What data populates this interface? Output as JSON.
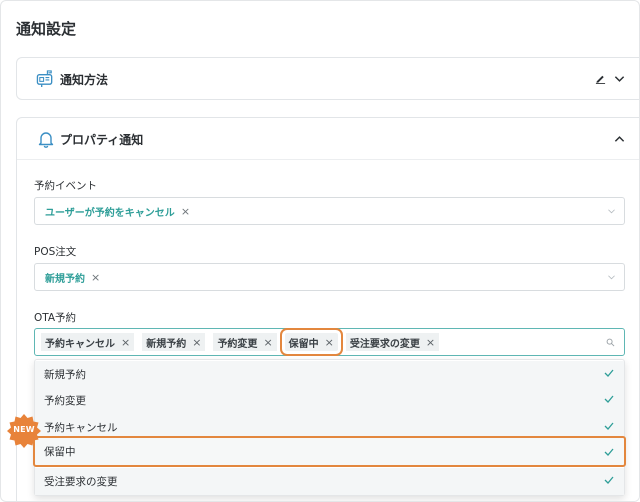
{
  "page": {
    "title": "通知設定"
  },
  "notify_method": {
    "title": "通知方法"
  },
  "property_notify": {
    "title": "プロパティ通知"
  },
  "reservation_event": {
    "label": "予約イベント",
    "chips": [
      {
        "label": "ユーザーが予約をキャンセル"
      }
    ]
  },
  "pos_order": {
    "label": "POS注文",
    "chips": [
      {
        "label": "新規予約"
      }
    ]
  },
  "ota_reservation": {
    "label": "OTA予約",
    "chips": [
      {
        "label": "予約キャンセル"
      },
      {
        "label": "新規予約"
      },
      {
        "label": "予約変更"
      },
      {
        "label": "保留中"
      },
      {
        "label": "受注要求の変更"
      }
    ]
  },
  "dropdown": {
    "options": [
      {
        "label": "新規予約",
        "checked": true
      },
      {
        "label": "予約変更",
        "checked": true
      },
      {
        "label": "予約キャンセル",
        "checked": true
      },
      {
        "label": "保留中",
        "checked": true
      },
      {
        "label": "受注要求の変更",
        "checked": true
      }
    ]
  },
  "badge": {
    "label": "NEW"
  },
  "colors": {
    "accent": "#2e9e98",
    "highlight": "#e3873e",
    "badge": "#e8833a",
    "text": "#2b2f33"
  },
  "chip_close_glyph": "×",
  "icons": [
    "mailbox-icon",
    "bell-icon",
    "pencil-icon",
    "chevron-down-icon",
    "chevron-up-icon",
    "caret-down-icon",
    "search-icon",
    "check-icon"
  ]
}
